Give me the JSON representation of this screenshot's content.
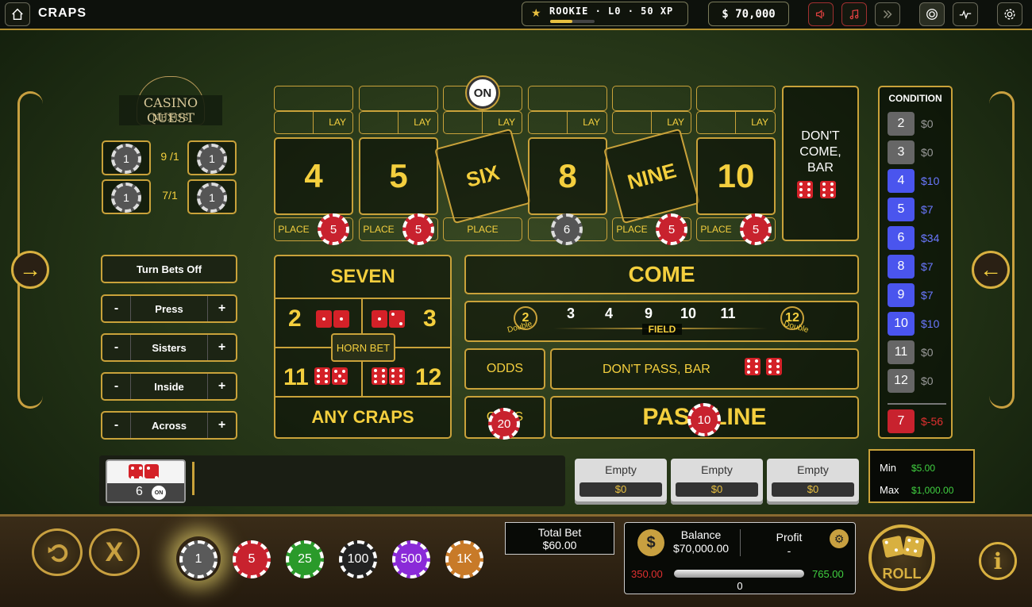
{
  "topbar": {
    "title": "CRAPS",
    "rank": "ROOKIE · L0 · 50 XP",
    "xp_progress": 0.5,
    "balance": "$ 70,000",
    "icons": [
      "home-icon",
      "star-icon",
      "sound-icon",
      "music-icon",
      "fast-forward-icon",
      "target-icon",
      "pulse-icon",
      "gear-icon"
    ]
  },
  "logo": {
    "line1": "CASINO QUEST",
    "line2": "NEXUS"
  },
  "hardways": [
    {
      "left_chip": "1",
      "right_chip": "1",
      "payout": "9 /1"
    },
    {
      "left_chip": "1",
      "right_chip": "1",
      "payout": "7/1"
    }
  ],
  "controls": {
    "turn_bets_off": "Turn Bets Off",
    "rows": [
      {
        "minus": "-",
        "label": "Press",
        "plus": "+"
      },
      {
        "minus": "-",
        "label": "Sisters",
        "plus": "+"
      },
      {
        "minus": "-",
        "label": "Inside",
        "plus": "+"
      },
      {
        "minus": "-",
        "label": "Across",
        "plus": "+"
      }
    ]
  },
  "puck": "ON",
  "numbers": [
    {
      "label": "4",
      "lay": "LAY",
      "place": "PLACE",
      "chip": "5"
    },
    {
      "label": "5",
      "lay": "LAY",
      "place": "PLACE",
      "chip": "5"
    },
    {
      "label": "SIX",
      "lay": "LAY",
      "place": "PLACE",
      "chip": ""
    },
    {
      "label": "8",
      "lay": "LAY",
      "place": "",
      "chip": "6"
    },
    {
      "label": "NINE",
      "lay": "LAY",
      "place": "PLACE",
      "chip": "5"
    },
    {
      "label": "10",
      "lay": "LAY",
      "place": "PLACE",
      "chip": "5"
    }
  ],
  "dont_come": {
    "line1": "DON'T",
    "line2": "COME,",
    "line3": "BAR"
  },
  "props": {
    "seven": "SEVEN",
    "two": "2",
    "three": "3",
    "eleven": "11",
    "twelve": "12",
    "horn": "HORN BET",
    "any_craps": "ANY CRAPS"
  },
  "come": "COME",
  "field": {
    "nums": [
      "3",
      "4",
      "9",
      "10",
      "11"
    ],
    "left": "2",
    "right": "12",
    "double": "Double",
    "label": "FIELD"
  },
  "odds": "ODDS",
  "dont_pass": "DON'T PASS, BAR",
  "pass_line": "PASS LINE",
  "odds2": "ODDS",
  "odds_chip": "20",
  "pass_chip": "10",
  "condition": {
    "title": "CONDITION",
    "rows": [
      {
        "n": "2",
        "v": "$0",
        "color": "#666666",
        "vcolor": "#999999"
      },
      {
        "n": "3",
        "v": "$0",
        "color": "#666666",
        "vcolor": "#999999"
      },
      {
        "n": "4",
        "v": "$10",
        "color": "#4a55ee",
        "vcolor": "#6a78ff"
      },
      {
        "n": "5",
        "v": "$7",
        "color": "#4a55ee",
        "vcolor": "#6a78ff"
      },
      {
        "n": "6",
        "v": "$34",
        "color": "#4a55ee",
        "vcolor": "#6a78ff"
      },
      {
        "n": "8",
        "v": "$7",
        "color": "#4a55ee",
        "vcolor": "#6a78ff"
      },
      {
        "n": "9",
        "v": "$7",
        "color": "#4a55ee",
        "vcolor": "#6a78ff"
      },
      {
        "n": "10",
        "v": "$10",
        "color": "#4a55ee",
        "vcolor": "#6a78ff"
      },
      {
        "n": "11",
        "v": "$0",
        "color": "#666666",
        "vcolor": "#999999"
      },
      {
        "n": "12",
        "v": "$0",
        "color": "#666666",
        "vcolor": "#999999"
      }
    ],
    "seven": {
      "n": "7",
      "v": "$-56"
    }
  },
  "history": {
    "value": "6",
    "badge": "ON"
  },
  "slots": [
    {
      "label": "Empty",
      "value": "$0"
    },
    {
      "label": "Empty",
      "value": "$0"
    },
    {
      "label": "Empty",
      "value": "$0"
    }
  ],
  "limits": {
    "min_label": "Min",
    "min": "$5.00",
    "max_label": "Max",
    "max": "$1,000.00"
  },
  "bottom": {
    "total_bet_label": "Total Bet",
    "total_bet": "$60.00",
    "balance_label": "Balance",
    "balance": "$70,000.00",
    "profit_label": "Profit",
    "profit": "-",
    "range_min": "350.00",
    "range_max": "765.00",
    "range_val": "0",
    "roll": "ROLL",
    "chips": [
      {
        "v": "1",
        "c": "#5a5a5a"
      },
      {
        "v": "5",
        "c": "#c8222e"
      },
      {
        "v": "25",
        "c": "#2a9a2a"
      },
      {
        "v": "100",
        "c": "#222222"
      },
      {
        "v": "500",
        "c": "#8a2ad8"
      },
      {
        "v": "1K",
        "c": "#c87a28"
      }
    ]
  }
}
